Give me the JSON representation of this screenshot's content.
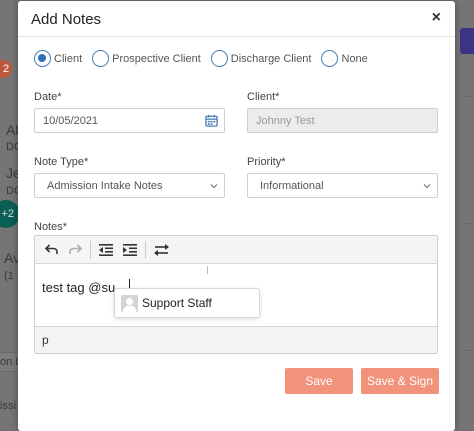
{
  "background": {
    "badge": "2",
    "items": [
      "Al",
      "DC",
      "Je",
      "DC",
      "Av",
      "(1"
    ],
    "circle_badge": "+2",
    "tab_fragment": "on L",
    "bottom_fragment": "issi"
  },
  "modal": {
    "title": "Add Notes",
    "close_label": "×"
  },
  "client_type": {
    "options": [
      "Client",
      "Prospective Client",
      "Discharge Client",
      "None"
    ],
    "selected": "Client"
  },
  "date": {
    "label": "Date*",
    "value": "10/05/2021"
  },
  "client": {
    "label": "Client*",
    "value": "Johnny Test"
  },
  "note_type": {
    "label": "Note Type*",
    "value": "Admission Intake Notes"
  },
  "priority": {
    "label": "Priority*",
    "value": "Informational"
  },
  "notes": {
    "label": "Notes*",
    "content": "test tag @su",
    "status_path": "p",
    "mention_suggestion": "Support Staff"
  },
  "buttons": {
    "save": "Save",
    "save_sign": "Save & Sign"
  },
  "colors": {
    "primary_button": "#f0937a",
    "radio_accent": "#2f6fb8",
    "overlay": "#757575"
  }
}
